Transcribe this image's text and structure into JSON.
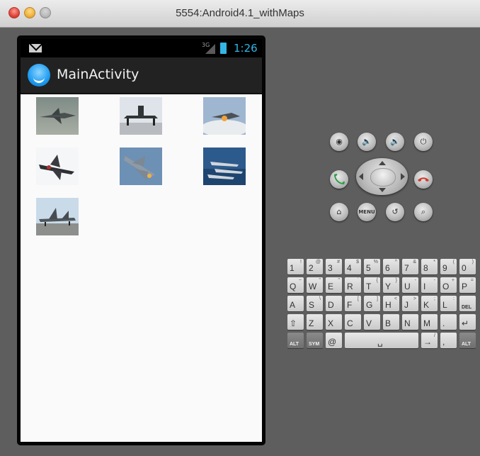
{
  "window": {
    "title": "5554:Android4.1_withMaps"
  },
  "status_bar": {
    "network": "3G",
    "time": "1:26",
    "icons": [
      "mail-icon",
      "signal-icon",
      "battery-icon"
    ]
  },
  "action_bar": {
    "title": "MainActivity",
    "icon": "app-icon"
  },
  "gallery": {
    "images": [
      {
        "name": "fighter-jet-1"
      },
      {
        "name": "fighter-jet-2"
      },
      {
        "name": "fighter-jet-3"
      },
      {
        "name": "fighter-jet-4"
      },
      {
        "name": "fighter-jet-5"
      },
      {
        "name": "fighter-jet-6"
      },
      {
        "name": "fighter-jet-7"
      }
    ]
  },
  "controls": {
    "row1": [
      "camera-icon",
      "volume-down-icon",
      "volume-up-icon",
      "power-icon"
    ],
    "row2": [
      "call-icon",
      "dpad",
      "end-call-icon"
    ],
    "row3": [
      "home-icon",
      "menu-button",
      "back-icon",
      "search-icon"
    ],
    "menu_label": "MENU"
  },
  "keyboard": {
    "row1": [
      [
        "1",
        "!"
      ],
      [
        "2",
        "@"
      ],
      [
        "3",
        "#"
      ],
      [
        "4",
        "$"
      ],
      [
        "5",
        "%"
      ],
      [
        "6",
        "^"
      ],
      [
        "7",
        "&"
      ],
      [
        "8",
        "*"
      ],
      [
        "9",
        "("
      ],
      [
        "0",
        ")"
      ]
    ],
    "row2": [
      [
        "Q",
        "~"
      ],
      [
        "W",
        "\""
      ],
      [
        "E",
        "\""
      ],
      [
        "R",
        "`"
      ],
      [
        "T",
        "{"
      ],
      [
        "Y",
        "}"
      ],
      [
        "U",
        "-"
      ],
      [
        "I",
        "-"
      ],
      [
        "O",
        "+"
      ],
      [
        "P",
        "="
      ]
    ],
    "row3": [
      [
        "A",
        ""
      ],
      [
        "S",
        "\\"
      ],
      [
        "D",
        ""
      ],
      [
        "F",
        "["
      ],
      [
        "G",
        "]"
      ],
      [
        "H",
        "<"
      ],
      [
        "J",
        ">"
      ],
      [
        "K",
        ";"
      ],
      [
        "L",
        ":"
      ],
      [
        "DEL",
        ""
      ]
    ],
    "row4": [
      [
        "⇧",
        ""
      ],
      [
        "Z",
        ""
      ],
      [
        "X",
        ""
      ],
      [
        "C",
        ""
      ],
      [
        "V",
        ""
      ],
      [
        "B",
        ""
      ],
      [
        "N",
        ""
      ],
      [
        "M",
        ""
      ],
      [
        ".",
        ""
      ],
      [
        "↵",
        ""
      ]
    ],
    "row5": [
      [
        "ALT",
        ""
      ],
      [
        "SYM",
        ""
      ],
      [
        "@",
        ""
      ],
      [
        "␣",
        ""
      ],
      [
        "→",
        "/"
      ],
      [
        "/",
        "?"
      ],
      [
        ",",
        ""
      ],
      [
        "ALT",
        ""
      ]
    ]
  }
}
